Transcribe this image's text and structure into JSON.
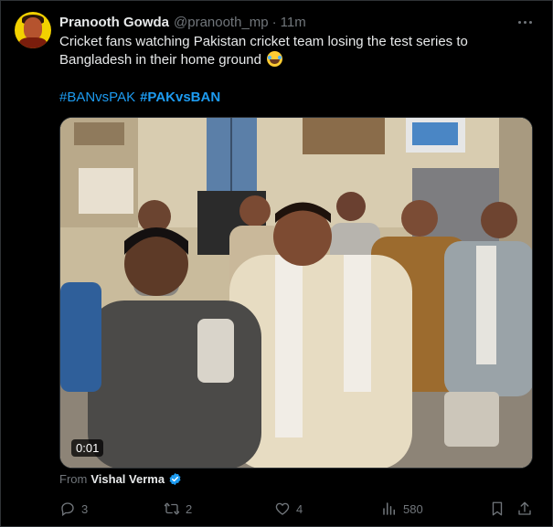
{
  "author": {
    "display_name": "Pranooth Gowda",
    "handle": "@pranooth_mp",
    "separator": "·",
    "time": "11m"
  },
  "tweet": {
    "text": "Cricket fans watching Pakistan cricket team losing the test series to Bangladesh in their home ground",
    "emoji": "face-with-tears-of-joy",
    "hashtags": [
      "#BANvsPAK",
      "#PAKvsBAN"
    ]
  },
  "media": {
    "type": "video",
    "description_icon": "video-thumbnail",
    "duration": "0:01"
  },
  "attribution": {
    "prefix": "From",
    "name": "Vishal Verma",
    "verified": true
  },
  "actions": {
    "replies": "3",
    "reposts": "2",
    "likes": "4",
    "views": "580"
  },
  "colors": {
    "background": "#000000",
    "text": "#e7e9ea",
    "muted": "#71767b",
    "link": "#1d9bf0",
    "avatar_bg": "#f2d100"
  }
}
